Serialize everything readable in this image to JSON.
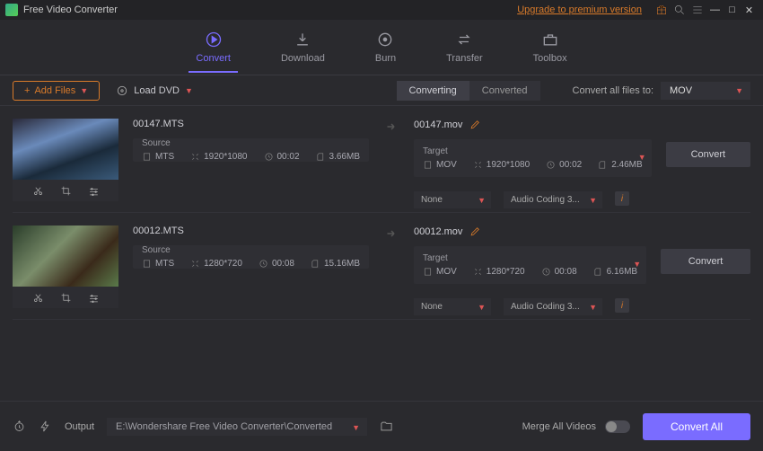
{
  "title": "Free Video Converter",
  "premium_link": "Upgrade to premium version",
  "tabs": {
    "convert": "Convert",
    "download": "Download",
    "burn": "Burn",
    "transfer": "Transfer",
    "toolbox": "Toolbox"
  },
  "subbar": {
    "add_files": "Add Files",
    "load_dvd": "Load DVD",
    "converting": "Converting",
    "converted": "Converted",
    "convert_all_to": "Convert all files to:",
    "format": "MOV"
  },
  "items": [
    {
      "src_name": "00147.MTS",
      "tgt_name": "00147.mov",
      "source_label": "Source",
      "target_label": "Target",
      "src": {
        "fmt": "MTS",
        "res": "1920*1080",
        "dur": "00:02",
        "size": "3.66MB"
      },
      "tgt": {
        "fmt": "MOV",
        "res": "1920*1080",
        "dur": "00:02",
        "size": "2.46MB"
      },
      "subtitle": "None",
      "audio": "Audio Coding 3...",
      "convert_btn": "Convert"
    },
    {
      "src_name": "00012.MTS",
      "tgt_name": "00012.mov",
      "source_label": "Source",
      "target_label": "Target",
      "src": {
        "fmt": "MTS",
        "res": "1280*720",
        "dur": "00:08",
        "size": "15.16MB"
      },
      "tgt": {
        "fmt": "MOV",
        "res": "1280*720",
        "dur": "00:08",
        "size": "6.16MB"
      },
      "subtitle": "None",
      "audio": "Audio Coding 3...",
      "convert_btn": "Convert"
    }
  ],
  "footer": {
    "output_label": "Output",
    "output_path": "E:\\Wondershare Free Video Converter\\Converted",
    "merge_label": "Merge All Videos",
    "convert_all": "Convert All"
  }
}
